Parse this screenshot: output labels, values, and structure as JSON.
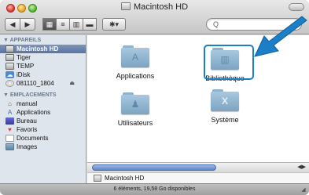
{
  "window": {
    "title": "Macintosh HD"
  },
  "toolbar": {
    "search_placeholder": "Q",
    "action_label": "✱▾"
  },
  "sidebar": {
    "devices_header": "▼ APPAREILS",
    "devices": [
      {
        "label": "Macintosh HD",
        "icon": "hard-drive-icon"
      },
      {
        "label": "Tiger",
        "icon": "hard-drive-icon"
      },
      {
        "label": "TEMP",
        "icon": "hard-drive-icon"
      },
      {
        "label": "iDisk",
        "icon": "idisk-icon"
      },
      {
        "label": "081110_1804",
        "icon": "disc-icon",
        "eject": "⏏"
      }
    ],
    "places_header": "▼ EMPLACEMENTS",
    "places": [
      {
        "label": "manual",
        "icon": "home-icon"
      },
      {
        "label": "Applications",
        "icon": "applications-icon"
      },
      {
        "label": "Bureau",
        "icon": "desktop-icon"
      },
      {
        "label": "Favoris",
        "icon": "favorites-icon"
      },
      {
        "label": "Documents",
        "icon": "documents-icon"
      },
      {
        "label": "Images",
        "icon": "images-icon"
      }
    ]
  },
  "content": {
    "folders": [
      {
        "label": "Applications",
        "icon": "applications-folder-icon",
        "emblem": "A"
      },
      {
        "label": "Bibliothèque",
        "icon": "library-folder-icon",
        "emblem": "▥"
      },
      {
        "label": "Utilisateurs",
        "icon": "users-folder-icon",
        "emblem": "♟"
      },
      {
        "label": "Système",
        "icon": "system-folder-icon",
        "emblem": "X"
      }
    ]
  },
  "pathbar": {
    "label": "Macintosh HD"
  },
  "status": {
    "text": "6 éléments, 19,58 Go disponibles"
  },
  "colors": {
    "highlight": "#1a7fc6",
    "selection": "#5a73a0"
  }
}
